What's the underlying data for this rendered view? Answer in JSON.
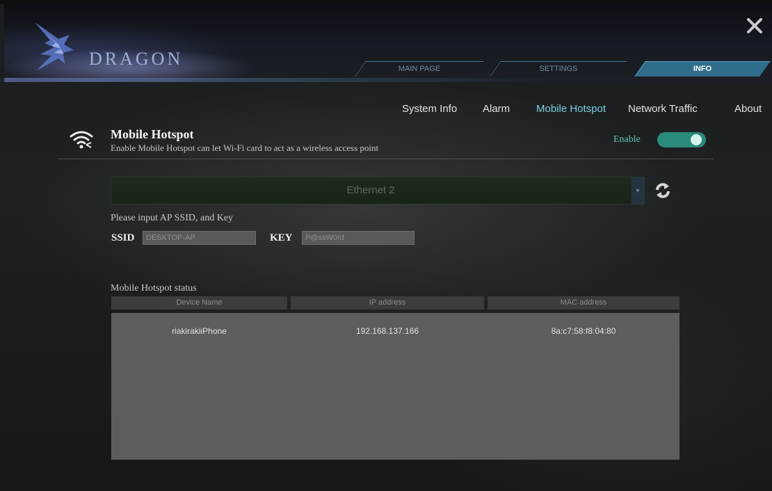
{
  "app": {
    "brand": "DRAGON"
  },
  "tabs": [
    {
      "label": "MAIN PAGE",
      "active": false
    },
    {
      "label": "SETTINGS",
      "active": false
    },
    {
      "label": "INFO",
      "active": true
    }
  ],
  "subnav": [
    {
      "label": "System Info",
      "active": false
    },
    {
      "label": "Alarm",
      "active": false
    },
    {
      "label": "Mobile Hotspot",
      "active": true
    },
    {
      "label": "Network Traffic",
      "active": false
    },
    {
      "label": "About",
      "active": false
    }
  ],
  "section": {
    "title": "Mobile Hotspot",
    "description": "Enable Mobile Hotspot can let Wi-Fi card to act as a wireless access point",
    "icon": "wifi-share-icon"
  },
  "enable": {
    "label": "Enable",
    "on": true
  },
  "adapter": {
    "selected": "Ethernet 2"
  },
  "form": {
    "prompt": "Please input AP SSID, and Key",
    "ssid_label": "SSID",
    "ssid_value": "DESKTOP-AP",
    "key_label": "KEY",
    "key_value": "P@ssW0rd"
  },
  "status": {
    "title": "Mobile Hotspot status",
    "columns": [
      "Device Name",
      "IP address",
      "MAC address"
    ],
    "rows": [
      [
        "riakirakiiPhone",
        "192.168.137.166",
        "8a:c7:58:f8:04:80"
      ]
    ]
  },
  "colors": {
    "accent": "#7bd0e0",
    "toggle_on": "#2a8a7c",
    "active_tab": "#2f6c8a"
  }
}
